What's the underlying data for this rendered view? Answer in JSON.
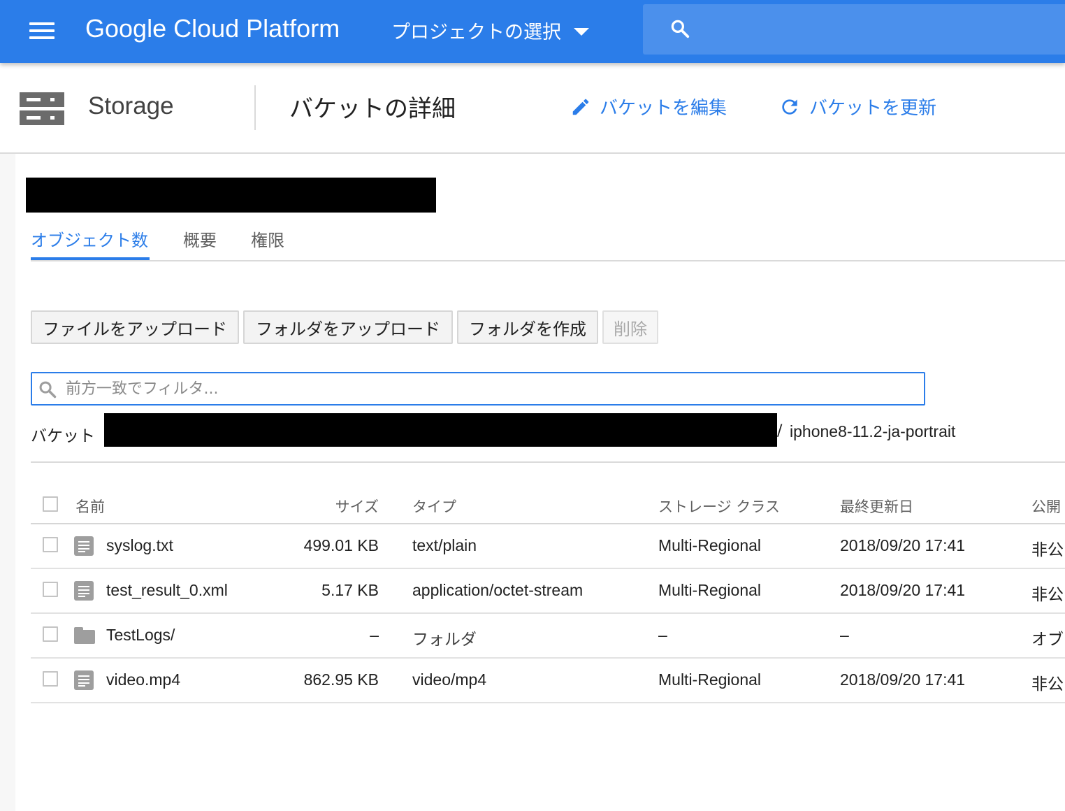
{
  "appbar": {
    "product_name": "Google Cloud Platform",
    "project_select_label": "プロジェクトの選択"
  },
  "subheader": {
    "section": "Storage",
    "page_title": "バケットの詳細",
    "edit_label": "バケットを編集",
    "refresh_label": "バケットを更新"
  },
  "tabs": [
    {
      "label": "オブジェクト数",
      "active": true
    },
    {
      "label": "概要",
      "active": false
    },
    {
      "label": "権限",
      "active": false
    }
  ],
  "toolbar": {
    "upload_files": "ファイルをアップロード",
    "upload_folder": "フォルダをアップロード",
    "create_folder": "フォルダを作成",
    "delete": "削除"
  },
  "filter": {
    "placeholder": "前方一致でフィルタ..."
  },
  "breadcrumb": {
    "label": "バケット",
    "separator": "/",
    "folder": "iphone8-11.2-ja-portrait"
  },
  "table": {
    "headers": {
      "name": "名前",
      "size": "サイズ",
      "type": "タイプ",
      "storage_class": "ストレージ クラス",
      "last_modified": "最終更新日",
      "public": "公開"
    },
    "rows": [
      {
        "name": "syslog.txt",
        "size": "499.01 KB",
        "type": "text/plain",
        "storage_class": "Multi-Regional",
        "last_modified": "2018/09/20 17:41",
        "public": "非公",
        "kind": "file"
      },
      {
        "name": "test_result_0.xml",
        "size": "5.17 KB",
        "type": "application/octet-stream",
        "storage_class": "Multi-Regional",
        "last_modified": "2018/09/20 17:41",
        "public": "非公",
        "kind": "file"
      },
      {
        "name": "TestLogs/",
        "size": "–",
        "type": "フォルダ",
        "storage_class": "–",
        "last_modified": "–",
        "public": "オブ",
        "kind": "folder"
      },
      {
        "name": "video.mp4",
        "size": "862.95 KB",
        "type": "video/mp4",
        "storage_class": "Multi-Regional",
        "last_modified": "2018/09/20 17:41",
        "public": "非公",
        "kind": "file"
      }
    ]
  },
  "colors": {
    "brand_blue": "#2b7de9",
    "search_blue": "#4b90ec"
  }
}
